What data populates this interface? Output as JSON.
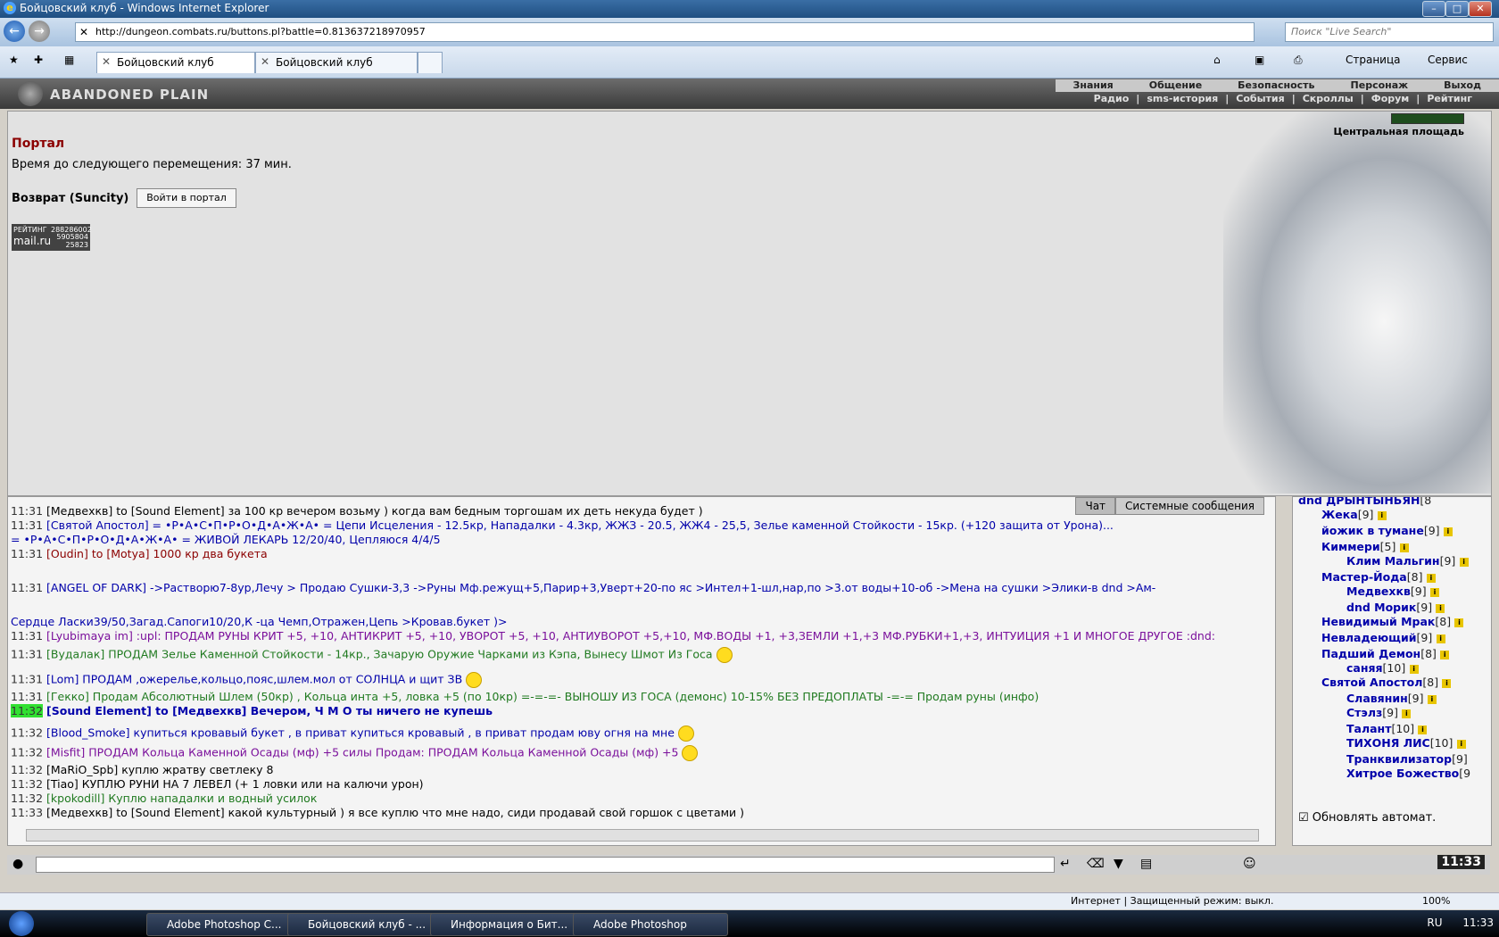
{
  "window": {
    "title": "Бойцовский клуб - Windows Internet Explorer",
    "url": "http://dungeon.combats.ru/buttons.pl?battle=0.813637218970957",
    "search_placeholder": "Поиск \"Live Search\"",
    "tabs": [
      "Бойцовский клуб",
      "Бойцовский клуб"
    ],
    "toolbar_page": "Страница",
    "toolbar_service": "Сервис"
  },
  "game": {
    "logo": "ABANDONED PLAIN",
    "menu": [
      "Знания",
      "Общение",
      "Безопасность",
      "Персонаж",
      "Выход"
    ],
    "submenu": [
      "Радио",
      "|",
      "sms-история",
      "|",
      "События",
      "|",
      "Скроллы",
      "|",
      "Форум",
      "|",
      "Рейтинг"
    ],
    "portal_title": "Портал",
    "time_line": "Время до следующего перемещения: 37 мин.",
    "return_label": "Возврат (Suncity)",
    "portal_button": "Войти в портал",
    "location": "Центральная площадь",
    "rating": {
      "label": "РЕЙТИНГ",
      "n1": "288286002",
      "brand": "mail.ru",
      "n2": "5905804",
      "n3": "25823"
    }
  },
  "chat": {
    "tab_chat": "Чат",
    "tab_system": "Системные сообщения",
    "lines": [
      {
        "time": "11:31",
        "text": "[Медвехкв] to [Sound Element] за 100 кр вечером возьму ) когда вам бедным торгошам их деть некуда будет )",
        "cls": ""
      },
      {
        "time": "11:31",
        "text": "[Святой Апостол] = •Р•А•С•П•Р•О•Д•А•Ж•А• = Цепи Исцеления - 12.5кр, Нападалки - 4.3кр, ЖЖЗ - 20.5, ЖЖ4 - 25,5, Зелье каменной Стойкости - 15кр. (+120 защита от Урона)...",
        "cls": "blue"
      },
      {
        "time": "",
        "text": "= •Р•А•С•П•Р•О•Д•А•Ж•А• = ЖИВОЙ ЛЕКАРЬ 12/20/40, Цепляюся 4/4/5",
        "cls": "blue"
      },
      {
        "time": "11:31",
        "text": "[Oudin] to [Motya] 1000 кр два букета",
        "cls": "darkred"
      },
      {
        "time": "11:31",
        "text": "[ANGEL OF DARK] ->Растворю7-8ур,Лечу  > Продаю Сушки-3,3 ->Руны Мф.режущ+5,Парир+3,Уверт+20-по яс >Интел+1-шл,нар,по   >3.от воды+10-об ->Мена на сушки >Элики-в dnd >Ам-",
        "cls": "blue"
      },
      {
        "time": "",
        "text": "Сердце Ласки39/50,Загад.Сапоги10/20,К -ца Чемп,Отражен,Цепь   >Кровав.букет )>",
        "cls": "blue"
      },
      {
        "time": "11:31",
        "text": "[Lyubimaya im] :upl: ПРОДАМ РУНЫ КРИТ +5, +10, АНТИКРИТ +5, +10, УВОРОТ +5, +10, АНТИУВОРОТ +5,+10, МФ.ВОДЫ +1, +3,ЗЕМЛИ +1,+3 МФ.РУБКИ+1,+3, ИНТУИЦИЯ +1 И МНОГОЕ ДРУГОЕ :dnd:",
        "cls": "purple"
      },
      {
        "time": "11:31",
        "text": "[Вудалак] ПРОДАМ Зелье Каменной Стойкости - 14кр., Зачарую Оружие Чарками из Кэпа, Вынесу Шмот Из Госа",
        "cls": "green"
      },
      {
        "time": "11:31",
        "text": "[Lom]   ПРОДАМ ,ожерелье,кольцо,пояс,шлем.мол от СОЛНЦА и щит ЗВ",
        "cls": "blue"
      },
      {
        "time": "11:31",
        "text": "[Гекко] Продам Абсолютный Шлем (50кр) , Кольца инта +5, ловка +5 (по 10кр) =-=-=- ВЫНОШУ ИЗ ГОСА (демонс) 10-15% БЕЗ ПРЕДОПЛАТЫ -=-= Продам руны (инфо)",
        "cls": "green"
      },
      {
        "time": "11:32",
        "text": "[Sound Element] to [Медвехкв] Вечером, Ч М О ты ничего не купешь",
        "cls": "",
        "hl": true
      },
      {
        "time": "11:32",
        "text": "[Blood_Smoke] купиться кровавый букет , в приват  купиться кровавый , в приват  продам юву огня на мне",
        "cls": "blue"
      },
      {
        "time": "11:32",
        "text": "[Misfit]  ПРОДАМ Кольца Каменной Осады (мф) +5 силы  Продам: ПРОДАМ Кольца Каменной Осады (мф) +5",
        "cls": "purple"
      },
      {
        "time": "11:32",
        "text": "[MaRiO_Spb] куплю жратву светлеку 8",
        "cls": ""
      },
      {
        "time": "11:32",
        "text": "[Tiao] КУПЛЮ РУНИ НА 7 ЛЕВЕЛ (+ 1 ловки или на калючи урон)",
        "cls": ""
      },
      {
        "time": "11:32",
        "text": "[kpokodill] Куплю нападалки и водный усилок",
        "cls": "green"
      },
      {
        "time": "11:33",
        "text": "[Медвехкв] to [Sound Element] какой культурный ) я все куплю что мне надо, сиди продавай свой горшок с цветами )",
        "cls": ""
      }
    ],
    "clock": "11:33"
  },
  "online": {
    "users": [
      {
        "name": "dnd ДРЫНТЫНЬЯН",
        "lvl": "[8"
      },
      {
        "name": "Жека",
        "lvl": "[9]"
      },
      {
        "name": "йожик в тумане",
        "lvl": "[9]"
      },
      {
        "name": "Киммери",
        "lvl": "[5]"
      },
      {
        "name": "Клим Мальгин",
        "lvl": "[9]"
      },
      {
        "name": "Мастер-Йода",
        "lvl": "[8]"
      },
      {
        "name": "Медвехкв",
        "lvl": "[9]"
      },
      {
        "name": "dnd Морик",
        "lvl": "[9]"
      },
      {
        "name": "Невидимый Мрак",
        "lvl": "[8]"
      },
      {
        "name": "Невладеющий",
        "lvl": "[9]"
      },
      {
        "name": "Падший Демон",
        "lvl": "[8]"
      },
      {
        "name": "саняя",
        "lvl": "[10]"
      },
      {
        "name": "Святой Апостол",
        "lvl": "[8]"
      },
      {
        "name": "Славянин",
        "lvl": "[9]"
      },
      {
        "name": "Стэлз",
        "lvl": "[9]"
      },
      {
        "name": "Талант",
        "lvl": "[10]"
      },
      {
        "name": "ТИХОНЯ ЛИС",
        "lvl": "[10]"
      },
      {
        "name": "Транквилизатор",
        "lvl": "[9]"
      },
      {
        "name": "Хитрое Божество",
        "lvl": "[9"
      }
    ],
    "auto_update": "Обновлять автомат."
  },
  "status": {
    "zone": "Интернет | Защищенный режим: выкл.",
    "zoom": "100%"
  },
  "taskbar": {
    "items": [
      "Adobe Photoshop C...",
      "Бойцовский клуб - ...",
      "Информация о Бит...",
      "Adobe Photoshop"
    ],
    "lang": "RU",
    "time": "11:33"
  }
}
